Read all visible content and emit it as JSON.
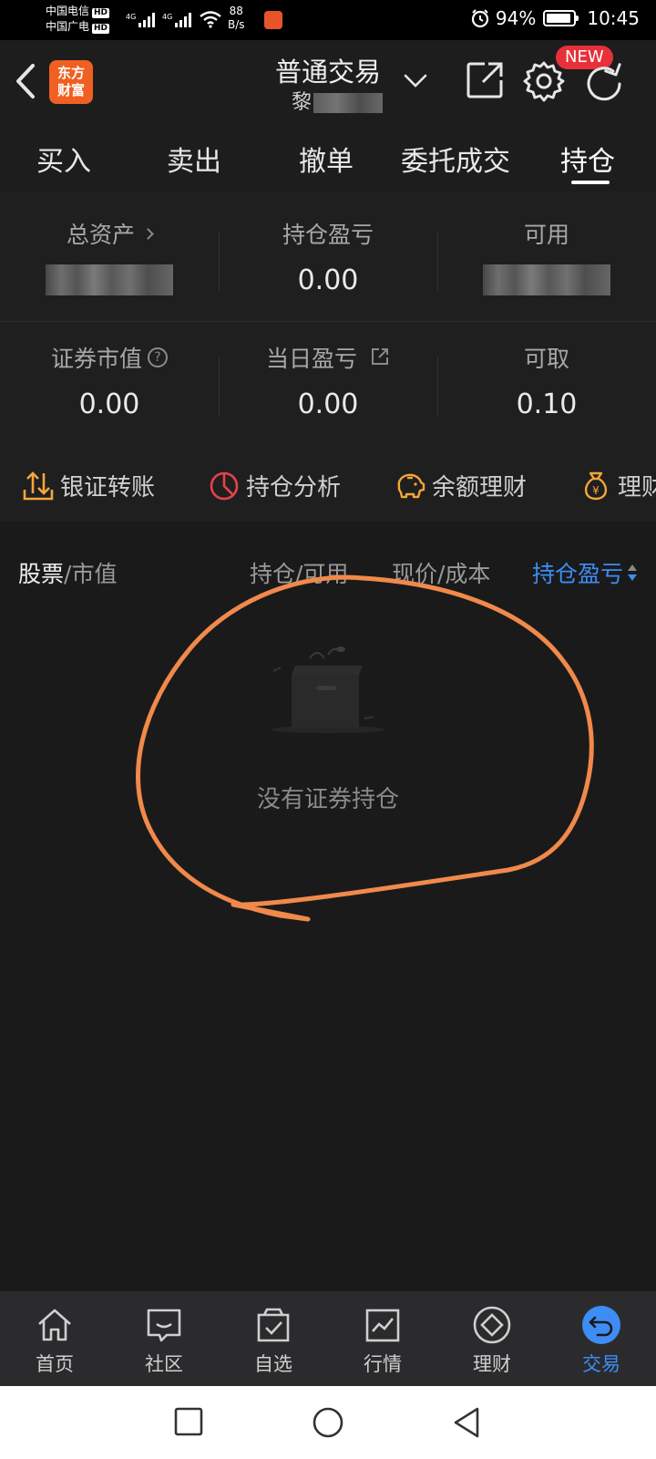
{
  "status_bar": {
    "carrier1": "中国电信",
    "carrier2": "中国广电",
    "hd": "HD",
    "net_type": "4G",
    "speed_value": "88",
    "speed_unit": "B/s",
    "battery": "94%",
    "battery_level": 0.94,
    "time": "10:45"
  },
  "header": {
    "logo_line1": "东方",
    "logo_line2": "财富",
    "title": "普通交易",
    "subtitle": "黎",
    "new_badge": "NEW"
  },
  "tabs": [
    {
      "label": "买入"
    },
    {
      "label": "卖出"
    },
    {
      "label": "撤单"
    },
    {
      "label": "委托成交"
    },
    {
      "label": "持仓"
    }
  ],
  "summary": {
    "total_assets_label": "总资产",
    "total_assets_value": "",
    "position_pl_label": "持仓盈亏",
    "position_pl_value": "0.00",
    "available_label": "可用",
    "available_value": "",
    "market_value_label": "证券市值",
    "market_value_value": "0.00",
    "daily_pl_label": "当日盈亏",
    "daily_pl_value": "0.00",
    "withdrawable_label": "可取",
    "withdrawable_value": "0.10"
  },
  "quick_actions": [
    {
      "label": "银证转账",
      "icon": "transfer-icon",
      "color": "#f5a637"
    },
    {
      "label": "持仓分析",
      "icon": "pie-chart-icon",
      "color": "#e8414a"
    },
    {
      "label": "余额理财",
      "icon": "piggy-bank-icon",
      "color": "#f5a637"
    },
    {
      "label": "理财",
      "icon": "money-bag-icon",
      "color": "#f5a637"
    }
  ],
  "holdings_header": {
    "stock": "股票",
    "market_value": "/市值",
    "position": "持仓/可用",
    "price": "现价/成本",
    "pl": "持仓盈亏"
  },
  "empty_state": {
    "text": "没有证券持仓"
  },
  "bottom_nav": [
    {
      "label": "首页",
      "icon": "home-icon"
    },
    {
      "label": "社区",
      "icon": "community-icon"
    },
    {
      "label": "自选",
      "icon": "watchlist-icon"
    },
    {
      "label": "行情",
      "icon": "market-icon"
    },
    {
      "label": "理财",
      "icon": "finance-icon"
    },
    {
      "label": "交易",
      "icon": "trade-icon",
      "active": true
    }
  ],
  "colors": {
    "accent": "#3d8df5",
    "brand": "#f06022",
    "annotation": "#f0894a"
  }
}
